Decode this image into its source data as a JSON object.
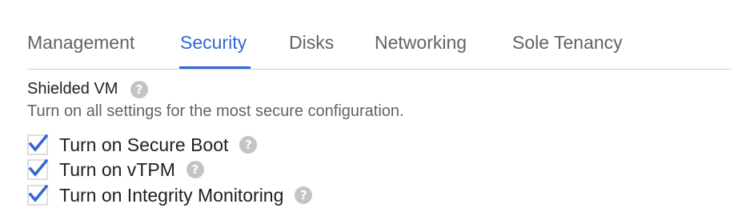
{
  "tabs": [
    {
      "label": "Management",
      "active": false
    },
    {
      "label": "Security",
      "active": true
    },
    {
      "label": "Disks",
      "active": false
    },
    {
      "label": "Networking",
      "active": false
    },
    {
      "label": "Sole Tenancy",
      "active": false
    }
  ],
  "shielded_vm": {
    "title": "Shielded VM",
    "help_icon": "help-icon",
    "description": "Turn on all settings for the most secure configuration.",
    "options": [
      {
        "label": "Turn on Secure Boot",
        "checked": true
      },
      {
        "label": "Turn on vTPM",
        "checked": true
      },
      {
        "label": "Turn on Integrity Monitoring",
        "checked": true
      }
    ]
  },
  "colors": {
    "accent": "#3367d6",
    "tab_text": "#5f6368",
    "divider": "#d0d0d0",
    "help_icon": "#c4c4c4"
  }
}
